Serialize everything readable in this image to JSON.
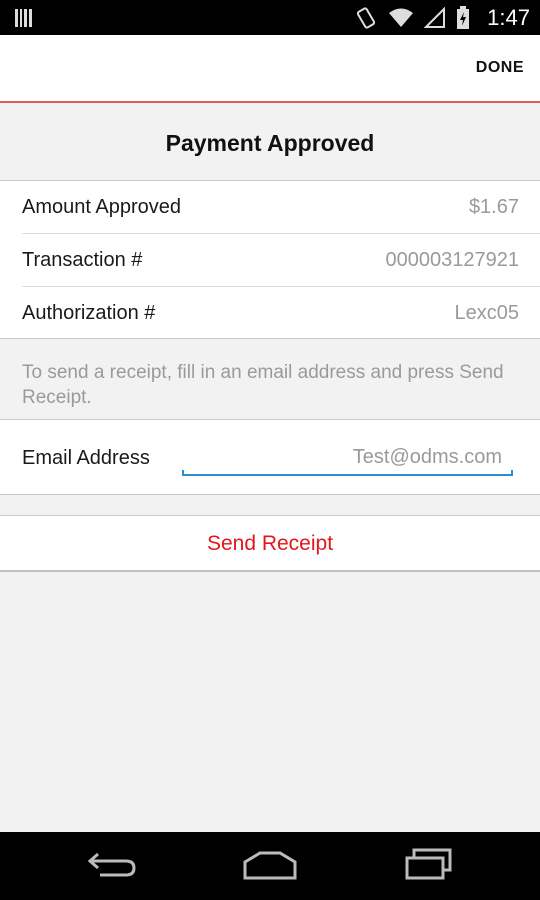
{
  "status_bar": {
    "time": "1:47",
    "icons": [
      "notification-barcode-icon",
      "vibrate-icon",
      "wifi-icon",
      "signal-icon",
      "battery-charging-icon"
    ]
  },
  "action_bar": {
    "done_label": "DONE"
  },
  "page": {
    "title": "Payment Approved"
  },
  "details": [
    {
      "label": "Amount Approved",
      "value": "$1.67"
    },
    {
      "label": "Transaction #",
      "value": "000003127921"
    },
    {
      "label": "Authorization #",
      "value": "Lexc05"
    }
  ],
  "receipt": {
    "hint": "To send a receipt, fill in an email address and press Send Receipt.",
    "email_label": "Email Address",
    "email_placeholder": "Test@odms.com",
    "email_value": "",
    "send_label": "Send Receipt"
  },
  "colors": {
    "accent": "#e3161c",
    "input_underline": "#2a8fd0"
  },
  "nav_bar": {
    "icons": [
      "back-icon",
      "home-icon",
      "recent-apps-icon"
    ]
  }
}
